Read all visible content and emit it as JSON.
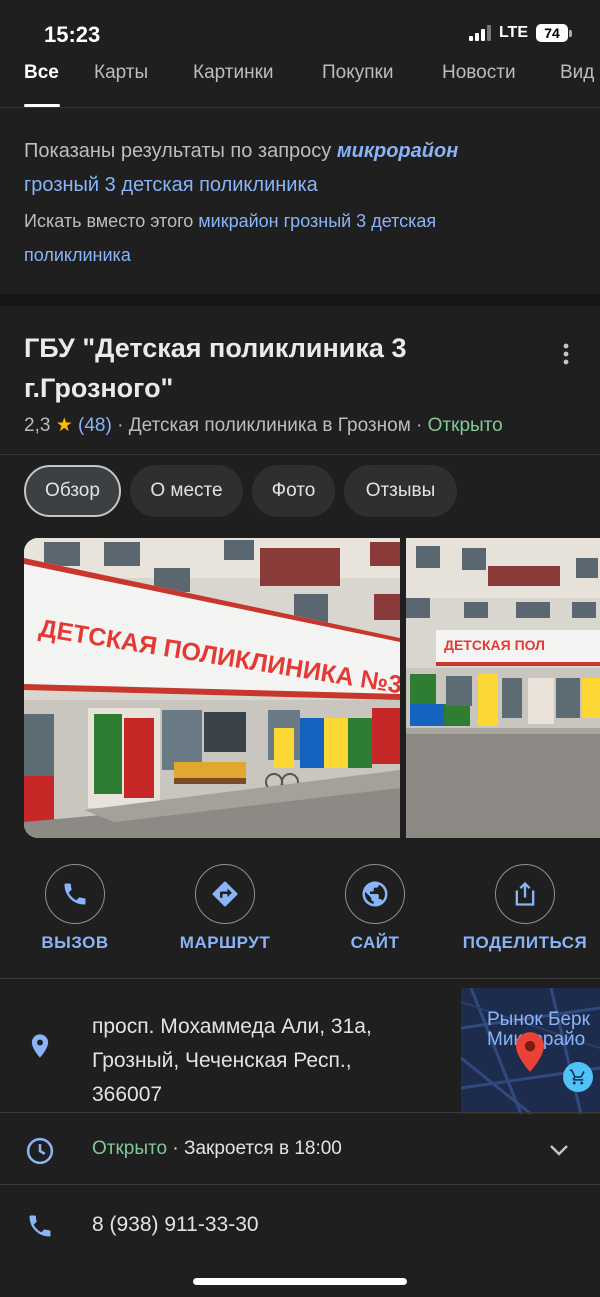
{
  "status": {
    "time": "15:23",
    "network": "LTE",
    "battery": "74"
  },
  "tabs": [
    {
      "label": "Все",
      "active": true
    },
    {
      "label": "Карты"
    },
    {
      "label": "Картинки"
    },
    {
      "label": "Покупки"
    },
    {
      "label": "Новости"
    },
    {
      "label": "Вид"
    }
  ],
  "spelling": {
    "shown_prefix": "Показаны результаты по запросу ",
    "shown_query_bold": "микрорайон",
    "shown_query_rest": "грозный 3 детская поликлиника",
    "instead_prefix": "Искать вместо этого ",
    "instead_query": "микрайон грозный 3 детская",
    "instead_query_rest": "поликлиника"
  },
  "place": {
    "title": "ГБУ \"Детская поликлиника 3 г.Грозного\"",
    "rating": "2,3",
    "star": "★",
    "review_count": "(48)",
    "category": "· Детская поликлиника в Грозном ·",
    "open_status": "Открыто",
    "photo_sign": "ДЕТСКАЯ ПОЛИКЛИНИКА №3",
    "photo_sign_short": "ДЕТСКАЯ ПОЛ"
  },
  "chips": [
    {
      "label": "Обзор",
      "active": true
    },
    {
      "label": "О месте"
    },
    {
      "label": "Фото"
    },
    {
      "label": "Отзывы"
    }
  ],
  "actions": [
    {
      "label": "ВЫЗОВ",
      "icon": "phone-icon"
    },
    {
      "label": "МАРШРУТ",
      "icon": "directions-icon"
    },
    {
      "label": "САЙТ",
      "icon": "globe-icon"
    },
    {
      "label": "ПОДЕЛИТЬСЯ",
      "icon": "share-icon"
    }
  ],
  "info": {
    "address_line1": "просп. Мохаммеда Али, 31а,",
    "address_line2": "Грозный, Чеченская Респ.,",
    "address_line3": "366007",
    "map_label_line1": "Рынок Берк",
    "map_label_line2": "Микрорайо",
    "hours_open": "Открыто",
    "hours_close": " · Закроется в 18:00",
    "phone": "8 (938) 911-33-30"
  },
  "colors": {
    "accent": "#8ab4f8",
    "open_green": "#81c995",
    "star": "#fbbc04",
    "pin": "#ea4335"
  }
}
